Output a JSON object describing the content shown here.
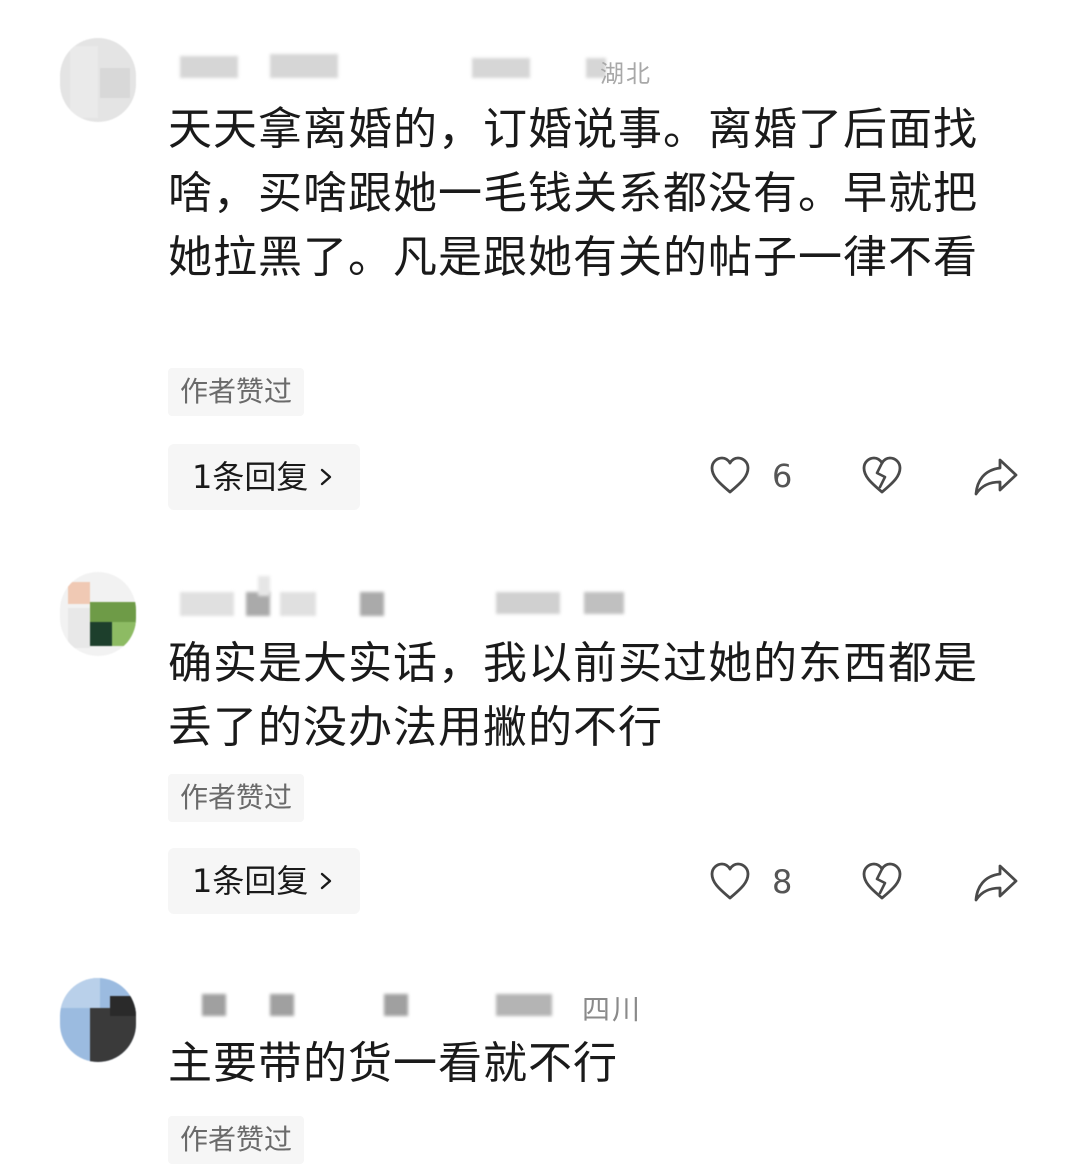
{
  "comments": [
    {
      "location_fragment": "湖北",
      "text": "天天拿离婚的，订婚说事。离婚了后面找啥，买啥跟她一毛钱关系都没有。早就把她拉黑了。凡是跟她有关的帖子一律不看",
      "author_liked_label": "作者赞过",
      "replies_label": "1条回复",
      "like_count": "6",
      "icons": {
        "like": "heart-icon",
        "dislike": "broken-heart-icon",
        "share": "share-arrow-icon",
        "replies": "chevron-right-icon"
      }
    },
    {
      "text": "确实是大实话，我以前买过她的东西都是丢了的没办法用撇的不行",
      "author_liked_label": "作者赞过",
      "replies_label": "1条回复",
      "like_count": "8",
      "icons": {
        "like": "heart-icon",
        "dislike": "broken-heart-icon",
        "share": "share-arrow-icon",
        "replies": "chevron-right-icon"
      }
    },
    {
      "location_fragment": "四川",
      "text": "主要带的货一看就不行",
      "author_liked_label": "作者赞过"
    }
  ]
}
